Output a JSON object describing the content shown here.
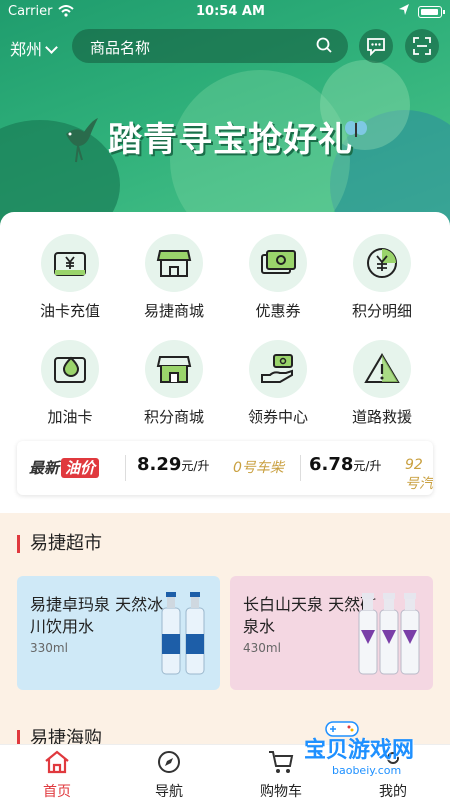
{
  "status": {
    "carrier": "Carrier",
    "time": "10:54 AM"
  },
  "header": {
    "city": "郑州",
    "search_placeholder": "商品名称",
    "icons": [
      "chat-icon",
      "scan-icon"
    ]
  },
  "banner": {
    "slogan": "踏青寻宝抢好礼"
  },
  "menu": [
    {
      "label": "油卡充值",
      "icon": "fuel-card-recharge-icon"
    },
    {
      "label": "易捷商城",
      "icon": "store-icon"
    },
    {
      "label": "优惠券",
      "icon": "coupon-icon"
    },
    {
      "label": "积分明细",
      "icon": "points-icon"
    },
    {
      "label": "加油卡",
      "icon": "fuel-card-icon"
    },
    {
      "label": "积分商城",
      "icon": "points-store-icon"
    },
    {
      "label": "领券中心",
      "icon": "coupon-center-icon"
    },
    {
      "label": "道路救援",
      "icon": "road-rescue-icon"
    }
  ],
  "oil": {
    "badge_prefix": "最新",
    "badge_suffix": "油价",
    "price1": "8.29",
    "unit1": "元/升",
    "type2": "0号车柴",
    "price2": "6.78",
    "unit2": "元/升",
    "type3": "92号汽"
  },
  "supermarket": {
    "title": "易捷超市",
    "products": [
      {
        "name": "易捷卓玛泉 天然冰川饮用水",
        "volume": "330ml",
        "color": "#cfe9f7"
      },
      {
        "name": "长白山天泉 天然矿泉水",
        "volume": "430ml",
        "color": "#f4d7e2"
      }
    ]
  },
  "next_section": {
    "title": "易捷海购"
  },
  "tabbar": [
    {
      "label": "首页",
      "icon": "home-icon",
      "active": true
    },
    {
      "label": "导航",
      "icon": "compass-icon",
      "active": false
    },
    {
      "label": "购物车",
      "icon": "cart-icon",
      "active": false
    },
    {
      "label": "我的",
      "icon": "user-icon",
      "active": false
    }
  ],
  "watermark": {
    "text": "宝贝游戏网",
    "url": "baobeiy.com"
  },
  "colors": {
    "primary_green": "#2fb07a",
    "accent_red": "#e0393e",
    "price_gold": "#c9a040"
  }
}
